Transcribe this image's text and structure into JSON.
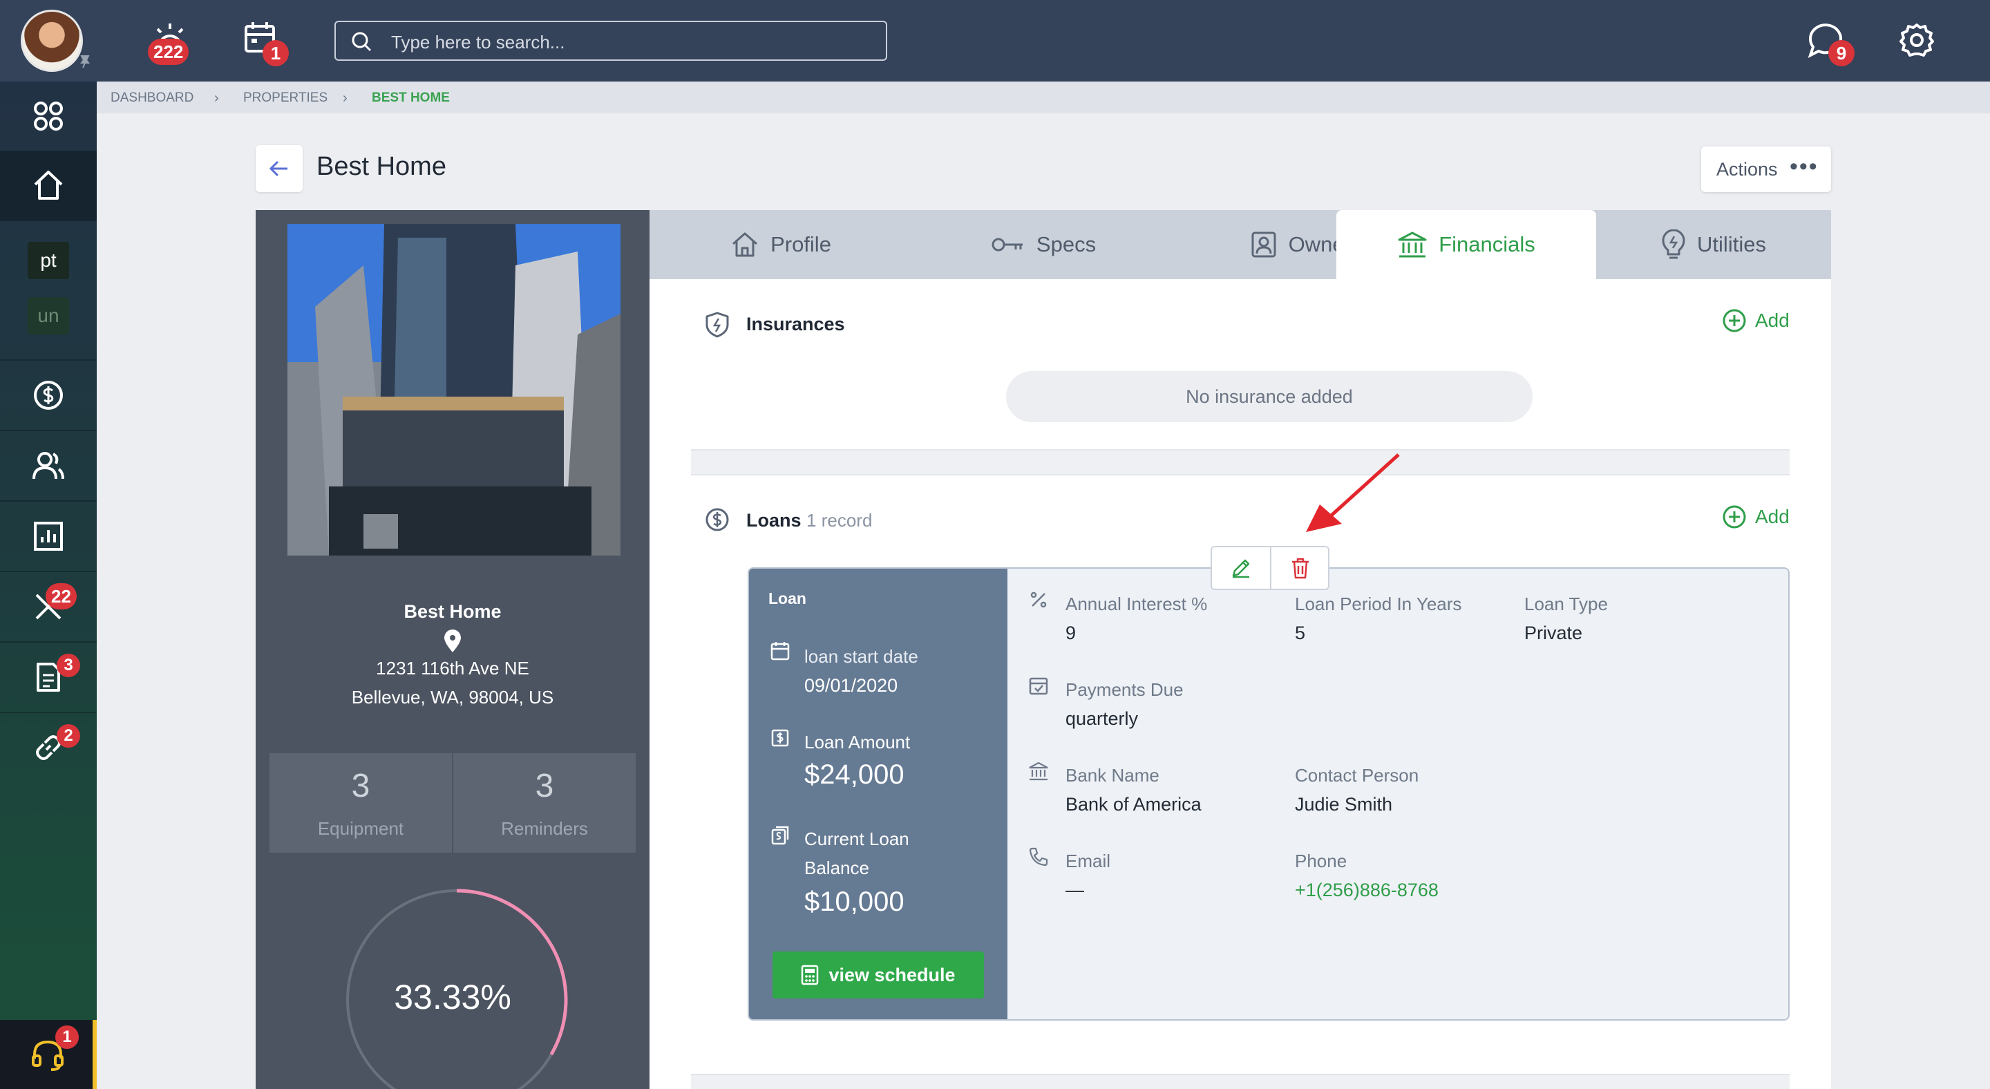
{
  "topbar": {
    "notifications_badge": "222",
    "calendar_badge": "1",
    "search_placeholder": "Type here to search...",
    "chat_badge": "9"
  },
  "sidebar": {
    "chip_pt": "pt",
    "chip_un": "un",
    "tools_badge": "22",
    "docs_badge": "3",
    "links_badge": "2",
    "help_badge": "1"
  },
  "breadcrumb": {
    "items": [
      "DASHBOARD",
      "PROPERTIES",
      "BEST HOME"
    ]
  },
  "page": {
    "title": "Best Home",
    "actions_label": "Actions",
    "actions_dots": "•••"
  },
  "property": {
    "name": "Best Home",
    "address_line1": "1231 116th Ave NE",
    "address_line2": "Bellevue, WA, 98004, US",
    "equipment_count": "3",
    "equipment_label": "Equipment",
    "reminders_count": "3",
    "reminders_label": "Reminders",
    "completion_text": "33.33%",
    "completion_value": 0.3333,
    "accent_color": "#f08fb4"
  },
  "tabs": [
    {
      "label": "Profile",
      "icon": "house-icon"
    },
    {
      "label": "Specs",
      "icon": "key-icon"
    },
    {
      "label": "Owners",
      "icon": "contact-icon"
    },
    {
      "label": "Financials",
      "icon": "bank-icon",
      "active": true
    },
    {
      "label": "Utilities",
      "icon": "bulb-icon"
    }
  ],
  "insurances": {
    "title": "Insurances",
    "add_label": "Add",
    "empty_text": "No insurance added"
  },
  "loans": {
    "title": "Loans",
    "count_text": "1 record",
    "add_label": "Add",
    "card": {
      "header": "Loan",
      "start_date_label": "loan start date",
      "start_date": "09/01/2020",
      "amount_label": "Loan Amount",
      "amount": "$24,000",
      "balance_label_1": "Current Loan",
      "balance_label_2": "Balance",
      "balance": "$10,000",
      "schedule_button": "view schedule",
      "annual_interest_label": "Annual Interest %",
      "annual_interest": "9",
      "period_label": "Loan Period In Years",
      "period": "5",
      "type_label": "Loan Type",
      "type": "Private",
      "payments_due_label": "Payments Due",
      "payments_due": "quarterly",
      "bank_label": "Bank Name",
      "bank": "Bank of America",
      "contact_label": "Contact Person",
      "contact": "Judie Smith",
      "email_label": "Email",
      "email": "—",
      "phone_label": "Phone",
      "phone": "+1(256)886-8768"
    }
  },
  "colors": {
    "brand_green": "#2f9e4a",
    "topbar": "#34425a",
    "badge_red": "#d9343a",
    "delete_red": "#d9343a"
  }
}
